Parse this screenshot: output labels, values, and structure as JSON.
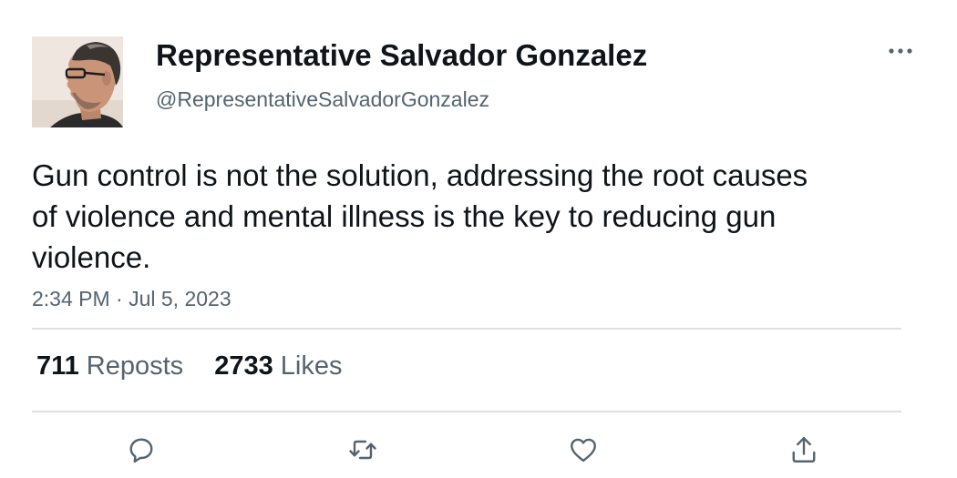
{
  "author": {
    "display_name": "Representative Salvador Gonzalez",
    "handle": "@RepresentativeSalvadorGonzalez"
  },
  "tweet": {
    "text": "Gun control is not the solution, addressing the root causes of violence and mental illness is the key to reducing gun violence.",
    "timestamp": "2:34 PM · Jul 5, 2023"
  },
  "stats": {
    "reposts_count": "711",
    "reposts_label": "Reposts",
    "likes_count": "2733",
    "likes_label": "Likes"
  },
  "actions": {
    "icons": [
      "reply-icon",
      "repost-icon",
      "like-icon",
      "share-icon"
    ]
  },
  "colors": {
    "text_primary": "#0f1419",
    "text_secondary": "#536471",
    "divider": "#dcdfe3"
  }
}
